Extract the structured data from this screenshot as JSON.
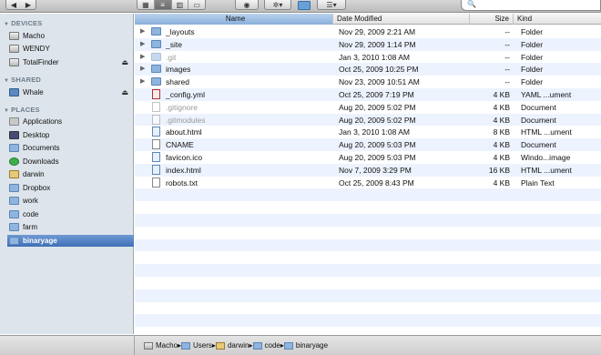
{
  "toolbar": {
    "back_icon": "back-arrow-icon",
    "forward_icon": "forward-arrow-icon",
    "view_modes": [
      "icon-view",
      "list-view",
      "column-view",
      "cover-flow-view"
    ],
    "active_view": "list-view",
    "search_placeholder": "",
    "search_icon": "🔍"
  },
  "sidebar": {
    "devices_label": "DEVICES",
    "devices": [
      {
        "label": "Macho",
        "icon": "drive-icon"
      },
      {
        "label": "WENDY",
        "icon": "drive-icon"
      },
      {
        "label": "TotalFinder",
        "icon": "drive-icon",
        "eject": true
      }
    ],
    "shared_label": "SHARED",
    "shared": [
      {
        "label": "Whale",
        "icon": "network-icon",
        "eject": true
      }
    ],
    "places_label": "PLACES",
    "places": [
      {
        "label": "Applications",
        "icon": "applications-icon"
      },
      {
        "label": "Desktop",
        "icon": "desktop-icon"
      },
      {
        "label": "Documents",
        "icon": "folder-icon"
      },
      {
        "label": "Downloads",
        "icon": "downloads-icon"
      },
      {
        "label": "darwin",
        "icon": "home-icon"
      },
      {
        "label": "Dropbox",
        "icon": "folder-icon"
      },
      {
        "label": "work",
        "icon": "folder-icon"
      },
      {
        "label": "code",
        "icon": "folder-icon"
      },
      {
        "label": "farm",
        "icon": "folder-icon"
      },
      {
        "label": "binaryage",
        "icon": "folder-icon",
        "selected": true
      }
    ]
  },
  "columns": {
    "name": "Name",
    "date": "Date Modified",
    "size": "Size",
    "kind": "Kind"
  },
  "files": [
    {
      "name": "_layouts",
      "date": "Nov 29, 2009 2:21 AM",
      "size": "--",
      "kind": "Folder",
      "type": "folder",
      "expandable": true
    },
    {
      "name": "_site",
      "date": "Nov 29, 2009 1:14 PM",
      "size": "--",
      "kind": "Folder",
      "type": "folder",
      "expandable": true
    },
    {
      "name": ".git",
      "date": "Jan 3, 2010 1:08 AM",
      "size": "--",
      "kind": "Folder",
      "type": "folder",
      "expandable": true,
      "hidden": true
    },
    {
      "name": "images",
      "date": "Oct 25, 2009 10:25 PM",
      "size": "--",
      "kind": "Folder",
      "type": "folder",
      "expandable": true
    },
    {
      "name": "shared",
      "date": "Nov 23, 2009 10:51 AM",
      "size": "--",
      "kind": "Folder",
      "type": "folder",
      "expandable": true
    },
    {
      "name": "_config.yml",
      "date": "Oct 25, 2009 7:19 PM",
      "size": "4 KB",
      "kind": "YAML ...ument",
      "type": "yaml"
    },
    {
      "name": ".gitignore",
      "date": "Aug 20, 2009 5:02 PM",
      "size": "4 KB",
      "kind": "Document",
      "type": "doc",
      "hidden": true
    },
    {
      "name": ".gitmodules",
      "date": "Aug 20, 2009 5:02 PM",
      "size": "4 KB",
      "kind": "Document",
      "type": "doc",
      "hidden": true
    },
    {
      "name": "about.html",
      "date": "Jan 3, 2010 1:08 AM",
      "size": "8 KB",
      "kind": "HTML ...ument",
      "type": "html"
    },
    {
      "name": "CNAME",
      "date": "Aug 20, 2009 5:03 PM",
      "size": "4 KB",
      "kind": "Document",
      "type": "doc"
    },
    {
      "name": "favicon.ico",
      "date": "Aug 20, 2009 5:03 PM",
      "size": "4 KB",
      "kind": "Windo...image",
      "type": "html"
    },
    {
      "name": "index.html",
      "date": "Nov 7, 2009 3:29 PM",
      "size": "16 KB",
      "kind": "HTML ...ument",
      "type": "html"
    },
    {
      "name": "robots.txt",
      "date": "Oct 25, 2009 8:43 PM",
      "size": "4 KB",
      "kind": "Plain Text",
      "type": "doc"
    }
  ],
  "pathbar": [
    "Macho",
    "Users",
    "darwin",
    "code",
    "binaryage"
  ],
  "colors": {
    "sidebar_bg": "#dde4eb",
    "selection": "#3f6fb5",
    "alt_row": "#edf3fe"
  }
}
